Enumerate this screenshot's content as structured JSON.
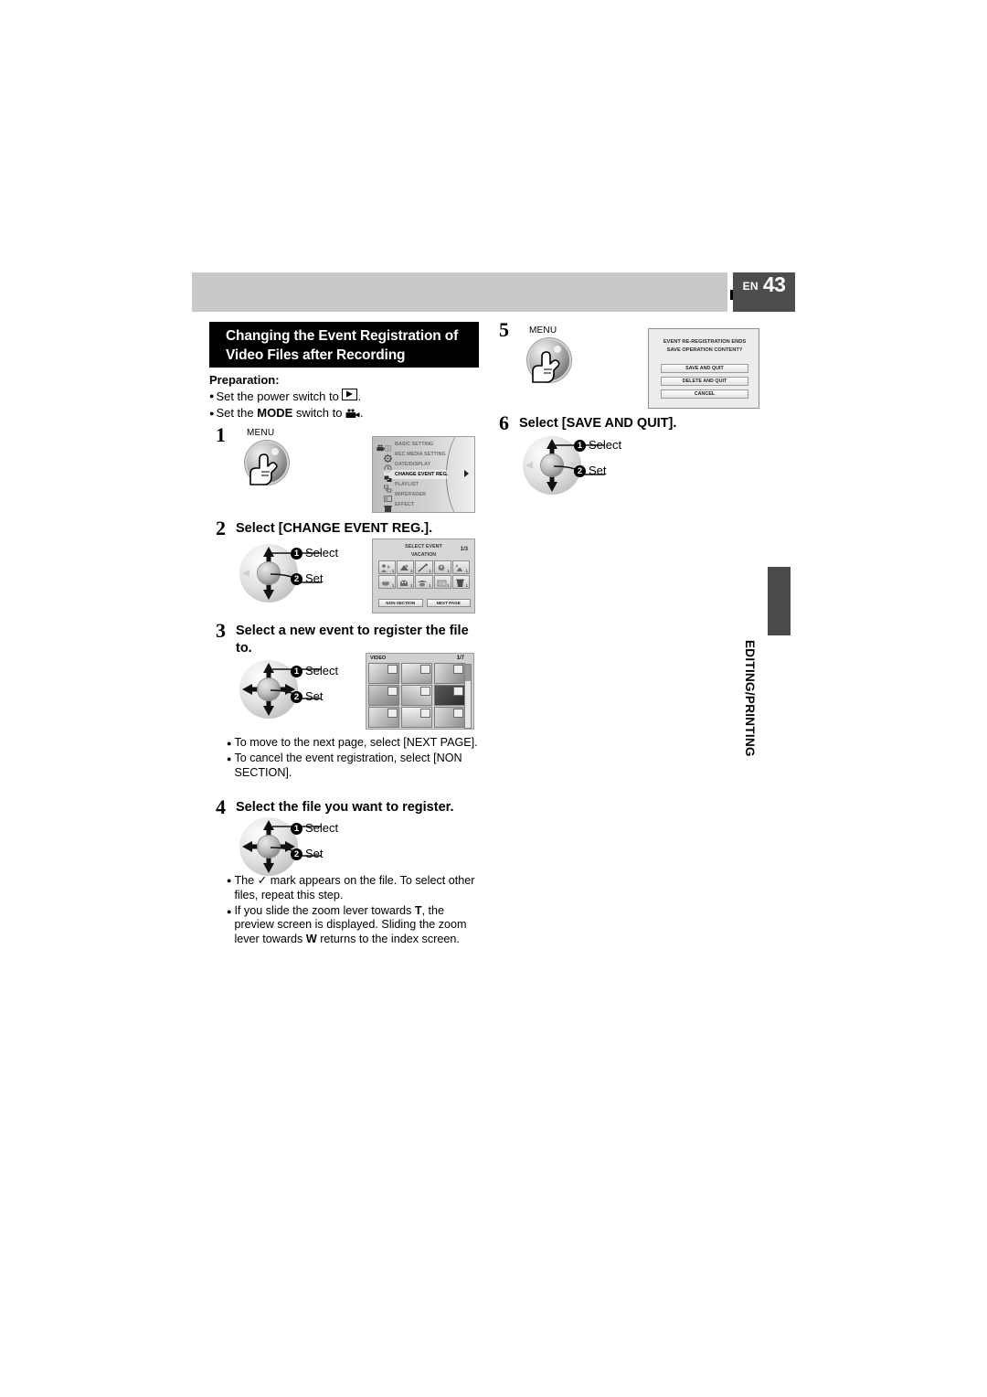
{
  "header": {
    "page_label": "EN",
    "page_number": "43",
    "icons": [
      "video-camera-icon",
      "still-camera-icon"
    ]
  },
  "title": {
    "line1": "Changing the Event Registration of",
    "line2": "Video Files after Recording"
  },
  "preparation": {
    "heading": "Preparation:",
    "items": [
      {
        "pre": "Set the power switch to ",
        "icon": "play-icon",
        "post": "."
      },
      {
        "pre": "Set the ",
        "bold": "MODE",
        "mid": " switch to ",
        "icon": "video-camera-icon",
        "post": "."
      }
    ]
  },
  "controller": {
    "select_label": "Select",
    "set_label": "Set",
    "select_num": "1",
    "set_num": "2"
  },
  "menu_button": {
    "label": "MENU"
  },
  "steps": [
    {
      "num": "1",
      "heading": ""
    },
    {
      "num": "2",
      "heading": "Select [CHANGE EVENT REG.]."
    },
    {
      "num": "3",
      "heading": "Select a new event to register the file to."
    },
    {
      "num": "4",
      "heading": "Select the file you want to register."
    },
    {
      "num": "5",
      "heading": ""
    },
    {
      "num": "6",
      "heading": "Select [SAVE AND QUIT]."
    }
  ],
  "menu_screen": {
    "items": [
      {
        "label": "BASIC SETTING",
        "icon": "sliders-icon",
        "selected": false
      },
      {
        "label": "REC MEDIA SETTING",
        "icon": "gear-icon",
        "selected": false
      },
      {
        "label": "DATE/DISPLAY",
        "icon": "clock-icon",
        "selected": false
      },
      {
        "label": "CHANGE EVENT REG.",
        "icon": "event-icon",
        "selected": true
      },
      {
        "label": "PLAYLIST",
        "icon": "playlist-icon",
        "selected": false
      },
      {
        "label": "WIPE/FADER",
        "icon": "wipe-icon",
        "selected": false
      },
      {
        "label": "EFFECT",
        "icon": "effect-icon",
        "selected": false
      }
    ]
  },
  "event_screen": {
    "title": "SELECT EVENT",
    "subtitle": "VACATION",
    "page": "1/3",
    "cells": [
      {
        "count": "1"
      },
      {
        "count": "1"
      },
      {
        "count": "1"
      },
      {
        "count": "1"
      },
      {
        "count": "1"
      },
      {
        "count": "1"
      },
      {
        "count": "1"
      },
      {
        "count": "1"
      },
      {
        "count": "1"
      },
      {
        "count": "1"
      }
    ],
    "buttons": [
      "NON SECTION",
      "NEXT PAGE"
    ]
  },
  "video_screen": {
    "label": "VIDEO",
    "page": "1/7",
    "thumb_count": 9
  },
  "dialog": {
    "line1": "EVENT RE-REGISTRATION ENDS",
    "line2": "SAVE OPERATION CONTENT?",
    "buttons": [
      "SAVE AND QUIT",
      "DELETE AND QUIT",
      "CANCEL"
    ]
  },
  "notes_step3": [
    {
      "text": "To move to the next page, select [NEXT PAGE]."
    },
    {
      "text": "To cancel the event registration, select [NON SECTION]."
    }
  ],
  "notes_step4": [
    {
      "pre": "The ",
      "glyph": "check-mark",
      "post": " mark appears on the file. To select other files, repeat this step."
    },
    {
      "pre": "If you slide the zoom lever towards ",
      "bold1": "T",
      "mid": ", the preview screen is displayed. Sliding the zoom lever towards ",
      "bold2": "W",
      "post": " returns to the index screen."
    }
  ],
  "side_tab": {
    "label": "EDITING/PRINTING"
  },
  "colors": {
    "header_bar": "#c9c9c9",
    "badge": "#4d4d4d",
    "banner": "#000000",
    "side_tab": "#4a4a4a"
  }
}
